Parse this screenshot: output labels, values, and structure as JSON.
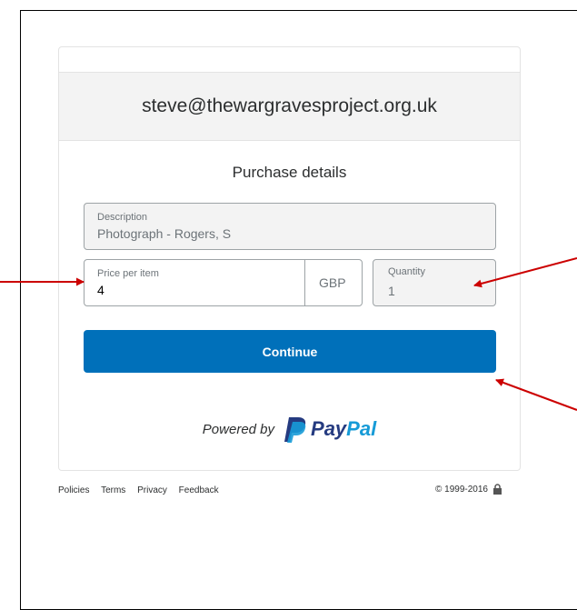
{
  "header": {
    "email": "steve@thewargravesproject.org.uk"
  },
  "section_title": "Purchase details",
  "description": {
    "label": "Description",
    "value": "Photograph - Rogers, S"
  },
  "price": {
    "label": "Price per item",
    "value": "4",
    "currency": "GBP"
  },
  "quantity": {
    "label": "Quantity",
    "value": "1"
  },
  "continue_label": "Continue",
  "powered_by": {
    "prefix": "Powered by",
    "brand_part1": "Pay",
    "brand_part2": "Pal"
  },
  "footer": {
    "links": [
      "Policies",
      "Terms",
      "Privacy",
      "Feedback"
    ],
    "copyright": "© 1999-2016"
  },
  "colors": {
    "button": "#0070ba",
    "annotation_arrow": "#cc0000",
    "paypal_dark": "#253b80",
    "paypal_light": "#179bd7"
  },
  "icons": [
    "paypal-logo-icon",
    "lock-icon",
    "annotation-arrow-icon"
  ]
}
